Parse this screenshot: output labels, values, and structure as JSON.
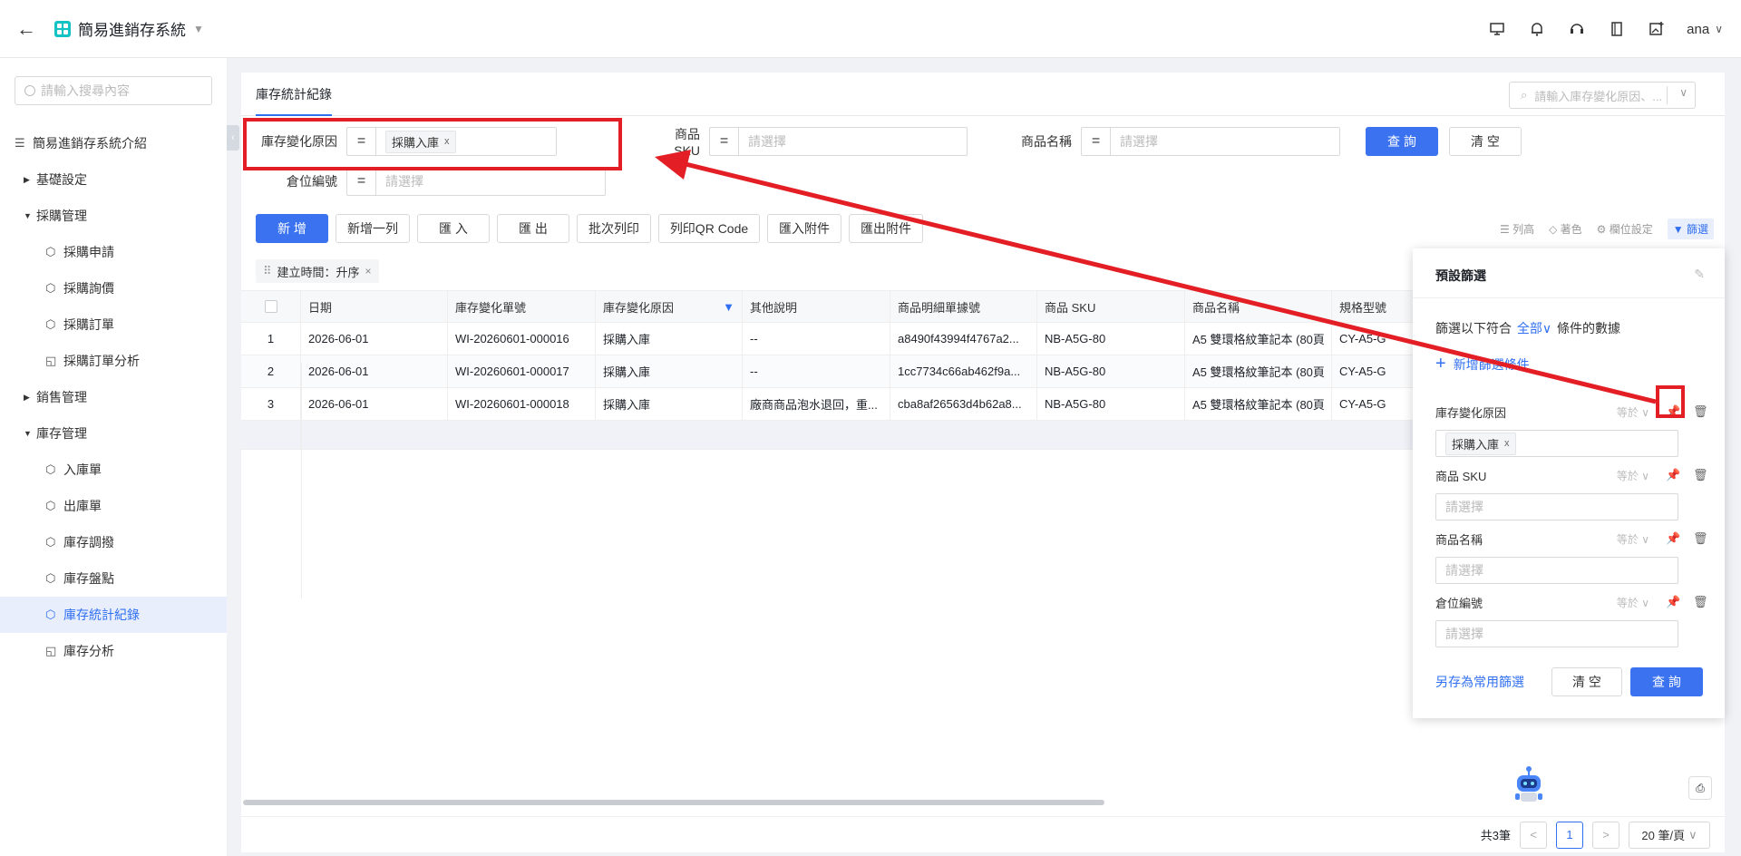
{
  "topbar": {
    "title": "簡易進銷存系統",
    "user": "ana"
  },
  "sidebar": {
    "search_placeholder": "請輸入搜尋內容",
    "items": [
      {
        "label": "簡易進銷存系統介紹"
      },
      {
        "label": "基礎設定"
      },
      {
        "label": "採購管理"
      },
      {
        "label": "採購申請"
      },
      {
        "label": "採購詢價"
      },
      {
        "label": "採購訂單"
      },
      {
        "label": "採購訂單分析"
      },
      {
        "label": "銷售管理"
      },
      {
        "label": "庫存管理"
      },
      {
        "label": "入庫單"
      },
      {
        "label": "出庫單"
      },
      {
        "label": "庫存調撥"
      },
      {
        "label": "庫存盤點"
      },
      {
        "label": "庫存統計紀錄"
      },
      {
        "label": "庫存分析"
      }
    ]
  },
  "page": {
    "tab": "庫存統計紀錄",
    "top_search_placeholder": "請輸入庫存變化原因、..."
  },
  "filters": {
    "eq": "=",
    "reason_label": "庫存變化原因",
    "reason_tag": "採購入庫",
    "sku_label": "商品 SKU",
    "sku_placeholder": "請選擇",
    "name_label": "商品名稱",
    "name_placeholder": "請選擇",
    "loc_label": "倉位編號",
    "loc_placeholder": "請選擇",
    "query": "查 詢",
    "clear": "清 空"
  },
  "toolbar": {
    "buttons": [
      "新 增",
      "新增一列",
      "匯 入",
      "匯 出",
      "批次列印",
      "列印QR Code",
      "匯入附件",
      "匯出附件"
    ],
    "right": [
      "列高",
      "著色",
      "欄位設定",
      "篩選"
    ]
  },
  "sort_chip": "建立時間：升序",
  "table": {
    "headers": [
      "日期",
      "庫存變化單號",
      "庫存變化原因",
      "其他說明",
      "商品明細單據號",
      "商品 SKU",
      "商品名稱",
      "規格型號"
    ],
    "rows": [
      [
        "1",
        "2026-06-01",
        "WI-20260601-000016",
        "採購入庫",
        "--",
        "a8490f43994f4767a2...",
        "NB-A5G-80",
        "A5 雙環格紋筆記本 (80頁",
        "CY-A5-G"
      ],
      [
        "2",
        "2026-06-01",
        "WI-20260601-000017",
        "採購入庫",
        "--",
        "1cc7734c66ab462f9a...",
        "NB-A5G-80",
        "A5 雙環格紋筆記本 (80頁",
        "CY-A5-G"
      ],
      [
        "3",
        "2026-06-01",
        "WI-20260601-000018",
        "採購入庫",
        "廠商商品泡水退回，重...",
        "cba8af26563d4b62a8...",
        "NB-A5G-80",
        "A5 雙環格紋筆記本 (80頁",
        "CY-A5-G"
      ]
    ]
  },
  "pager": {
    "total": "共3筆",
    "current": "1",
    "size": "20 筆/頁"
  },
  "panel": {
    "title": "預設篩選",
    "cond_prefix": "篩選以下符合",
    "cond_all": "全部",
    "cond_suffix": "條件的數據",
    "add": "新增篩選條件",
    "op": "等於",
    "fields": [
      {
        "label": "庫存變化原因",
        "tag": "採購入庫"
      },
      {
        "label": "商品 SKU",
        "placeholder": "請選擇"
      },
      {
        "label": "商品名稱",
        "placeholder": "請選擇"
      },
      {
        "label": "倉位編號",
        "placeholder": "請選擇"
      }
    ],
    "save": "另存為常用篩選",
    "clear": "清 空",
    "query": "查 詢"
  },
  "colors": {
    "accent": "#3a72f0",
    "annotation": "#e31f25"
  }
}
